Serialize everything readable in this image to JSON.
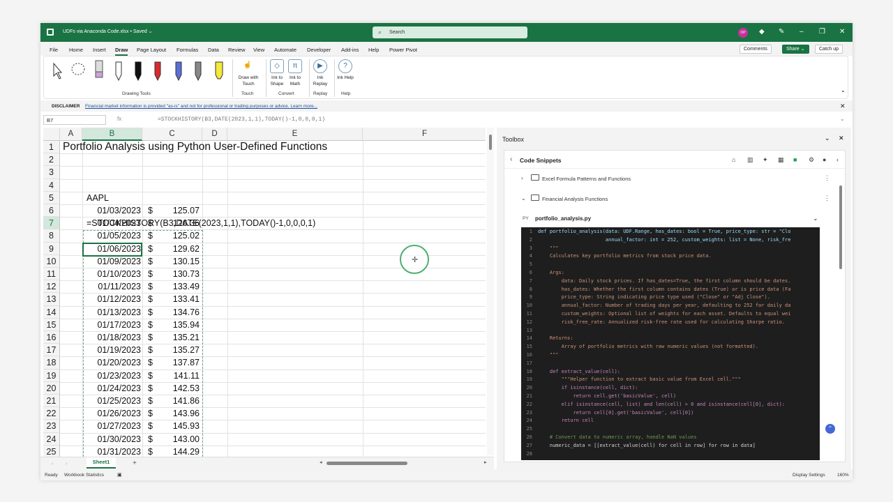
{
  "titlebar": {
    "doc_title": "UDFs via Anaconda Code.xlsx • Saved ⌄",
    "search_placeholder": "Search",
    "avatar_initials": "OP"
  },
  "menu": {
    "items": [
      "File",
      "Home",
      "Insert",
      "Draw",
      "Page Layout",
      "Formulas",
      "Data",
      "Review",
      "View",
      "Automate",
      "Developer",
      "Add-ins",
      "Help",
      "Power Pivot"
    ],
    "active": "Draw",
    "comments_label": "Comments",
    "share_label": "Share ⌄",
    "catchup_label": "Catch up"
  },
  "ribbon": {
    "drawing_tools_label": "Drawing Tools",
    "draw_with_touch": "Draw with Touch",
    "touch_label": "Touch",
    "ink_to_shape": "Ink to Shape",
    "ink_to_math": "Ink to Math",
    "convert_label": "Convert",
    "ink_replay": "Ink Replay",
    "replay_label": "Replay",
    "ink_help": "Ink Help",
    "help_label": "Help"
  },
  "disclaimer": {
    "label": "DISCLAIMER",
    "text": "Financial market information is provided \"as-is\" and not for professional or trading purposes or advice. Learn more..."
  },
  "formula_bar": {
    "name_box": "B7",
    "fx": "fx",
    "formula": "=STOCKHISTORY(B3,DATE(2023,1,1),TODAY()-1,0,0,0,1)"
  },
  "sheet": {
    "columns": [
      "A",
      "B",
      "C",
      "D",
      "E",
      "F"
    ],
    "selected_column": "B",
    "selected_row": 7,
    "rows": [
      "1",
      "2",
      "3",
      "4",
      "5",
      "6",
      "7",
      "8",
      "9",
      "10",
      "11",
      "12",
      "13",
      "14",
      "15",
      "16",
      "17",
      "18",
      "19",
      "20",
      "21",
      "22",
      "23",
      "24",
      "25"
    ],
    "title": "Portfolio Analysis using Python User-Defined Functions",
    "ticker": "AAPL",
    "formula_text": "=STOCKHISTORY(B3,DATE(2023,1,1),TODAY()-1,0,0,0,1)",
    "prices": [
      {
        "date": "01/03/2023",
        "cur": "$",
        "close": "125.07"
      },
      {
        "date": "01/04/2023",
        "cur": "$",
        "close": "126.36"
      },
      {
        "date": "01/05/2023",
        "cur": "$",
        "close": "125.02"
      },
      {
        "date": "01/06/2023",
        "cur": "$",
        "close": "129.62"
      },
      {
        "date": "01/09/2023",
        "cur": "$",
        "close": "130.15"
      },
      {
        "date": "01/10/2023",
        "cur": "$",
        "close": "130.73"
      },
      {
        "date": "01/11/2023",
        "cur": "$",
        "close": "133.49"
      },
      {
        "date": "01/12/2023",
        "cur": "$",
        "close": "133.41"
      },
      {
        "date": "01/13/2023",
        "cur": "$",
        "close": "134.76"
      },
      {
        "date": "01/17/2023",
        "cur": "$",
        "close": "135.94"
      },
      {
        "date": "01/18/2023",
        "cur": "$",
        "close": "135.21"
      },
      {
        "date": "01/19/2023",
        "cur": "$",
        "close": "135.27"
      },
      {
        "date": "01/20/2023",
        "cur": "$",
        "close": "137.87"
      },
      {
        "date": "01/23/2023",
        "cur": "$",
        "close": "141.11"
      },
      {
        "date": "01/24/2023",
        "cur": "$",
        "close": "142.53"
      },
      {
        "date": "01/25/2023",
        "cur": "$",
        "close": "141.86"
      },
      {
        "date": "01/26/2023",
        "cur": "$",
        "close": "143.96"
      },
      {
        "date": "01/27/2023",
        "cur": "$",
        "close": "145.93"
      },
      {
        "date": "01/30/2023",
        "cur": "$",
        "close": "143.00"
      },
      {
        "date": "01/31/2023",
        "cur": "$",
        "close": "144.29"
      }
    ],
    "tab_name": "Sheet1"
  },
  "status": {
    "ready": "Ready",
    "workbook_stats": "Workbook Statistics",
    "display_settings": "Display Settings",
    "zoom": "160%"
  },
  "toolbox": {
    "title": "Toolbox",
    "panel_title": "Code Snippets",
    "folders": [
      {
        "name": "Excel Formula Patterns and Functions",
        "expanded": false
      },
      {
        "name": "Financial Analysis Functions",
        "expanded": true
      }
    ],
    "file_type": "PY",
    "file_name": "portfolio_analysis.py",
    "code_lines": [
      {
        "n": "1",
        "t": "def portfolio_analysis(data: UDF.Range, has_dates: bool = True, price_type: str = \"Clo"
      },
      {
        "n": "2",
        "t": "                       annual_factor: int = 252, custom_weights: list = None, risk_fre"
      },
      {
        "n": "3",
        "t": "    \"\"\""
      },
      {
        "n": "4",
        "t": "    Calculates key portfolio metrics from stock price data."
      },
      {
        "n": "5",
        "t": ""
      },
      {
        "n": "6",
        "t": "    Args:"
      },
      {
        "n": "7",
        "t": "        data: Daily stock prices. If has_dates=True, the first column should be dates."
      },
      {
        "n": "8",
        "t": "        has_dates: Whether the first column contains dates (True) or is price data (Fa"
      },
      {
        "n": "9",
        "t": "        price_type: String indicating price type used (\"Close\" or \"Adj Close\")."
      },
      {
        "n": "10",
        "t": "        annual_factor: Number of trading days per year, defaulting to 252 for daily da"
      },
      {
        "n": "11",
        "t": "        custom_weights: Optional list of weights for each asset. Defaults to equal wei"
      },
      {
        "n": "12",
        "t": "        risk_free_rate: Annualized risk-free rate used for calculating Sharpe ratio."
      },
      {
        "n": "13",
        "t": ""
      },
      {
        "n": "14",
        "t": "    Returns:"
      },
      {
        "n": "15",
        "t": "        Array of portfolio metrics with raw numeric values (not formatted)."
      },
      {
        "n": "16",
        "t": "    \"\"\""
      },
      {
        "n": "17",
        "t": ""
      },
      {
        "n": "18",
        "t": "    def extract_value(cell):"
      },
      {
        "n": "19",
        "t": "        \"\"\"Helper function to extract basic value from Excel cell.\"\"\""
      },
      {
        "n": "20",
        "t": "        if isinstance(cell, dict):"
      },
      {
        "n": "21",
        "t": "            return cell.get('basicValue', cell)"
      },
      {
        "n": "22",
        "t": "        elif isinstance(cell, list) and len(cell) > 0 and isinstance(cell[0], dict):"
      },
      {
        "n": "23",
        "t": "            return cell[0].get('basicValue', cell[0])"
      },
      {
        "n": "24",
        "t": "        return cell"
      },
      {
        "n": "25",
        "t": ""
      },
      {
        "n": "26",
        "t": "    # Convert data to numeric array, handle NaN values"
      },
      {
        "n": "27",
        "t": "    numeric_data = [[extract_value(cell) for cell in row] for row in data]"
      },
      {
        "n": "28",
        "t": ""
      }
    ]
  },
  "colors": {
    "excel_green": "#1a7343",
    "code_bg": "#1e1e1e"
  }
}
